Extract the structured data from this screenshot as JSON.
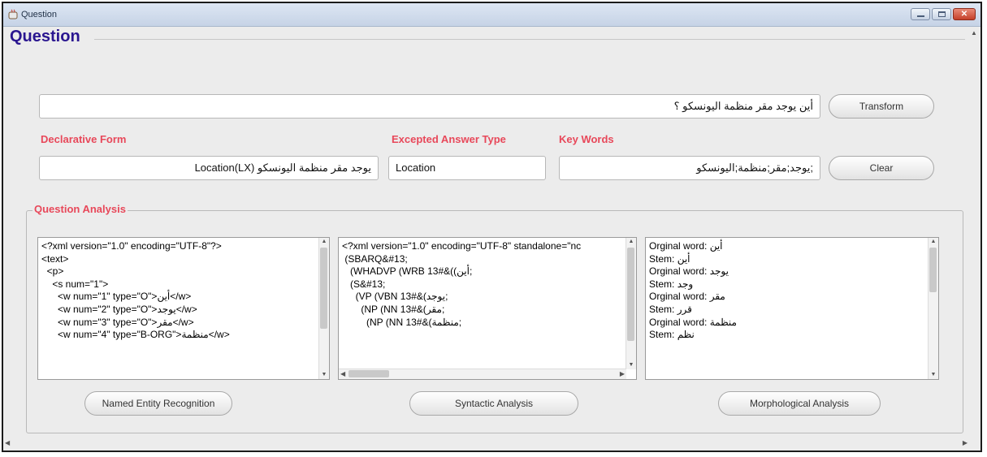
{
  "window": {
    "title": "Question"
  },
  "question": {
    "heading": "Question",
    "input_value": "أين يوجد مقر منظمة اليونسكو ؟",
    "transform_label": "Transform",
    "clear_label": "Clear"
  },
  "declarative": {
    "label": "Declarative Form",
    "value": "يوجد مقر منظمة اليونسكو Location(LX)"
  },
  "answer_type": {
    "label": "Excepted Answer Type",
    "value": "Location"
  },
  "keywords": {
    "label": "Key Words",
    "value": ";يوجد;مقر;منظمة;اليونسكو"
  },
  "analysis": {
    "legend": "Question Analysis",
    "ner_lines": [
      "<?xml version=\"1.0\" encoding=\"UTF-8\"?>",
      "<text>",
      "  <p>",
      "    <s num=\"1\">",
      "      <w num=\"1\" type=\"O\">أين</w>",
      "      <w num=\"2\" type=\"O\">يوجد</w>",
      "      <w num=\"3\" type=\"O\">مقر</w>",
      "      <w num=\"4\" type=\"B-ORG\">منظمة</w>"
    ],
    "syntax_lines": [
      "<?xml version=\"1.0\" encoding=\"UTF-8\" standalone=\"nc",
      " (SBARQ&#13;",
      "   (WHADVP (WRB 13#&((أين;",
      "   (S&#13;",
      "     (VP (VBN 13#&(يوجد;",
      "       (NP (NN 13#&(مقر;",
      "         (NP (NN 13#&(منظمة;"
    ],
    "morph_lines": [
      "Orginal word: أين",
      "Stem: أين",
      "Orginal word: يوجد",
      "Stem: وجد",
      "Orginal word: مقر",
      "Stem: قرر",
      "Orginal word: منظمة",
      "Stem: نظم"
    ],
    "ner_button": "Named Entity Recognition",
    "syntax_button": "Syntactic Analysis",
    "morph_button": "Morphological Analysis"
  }
}
